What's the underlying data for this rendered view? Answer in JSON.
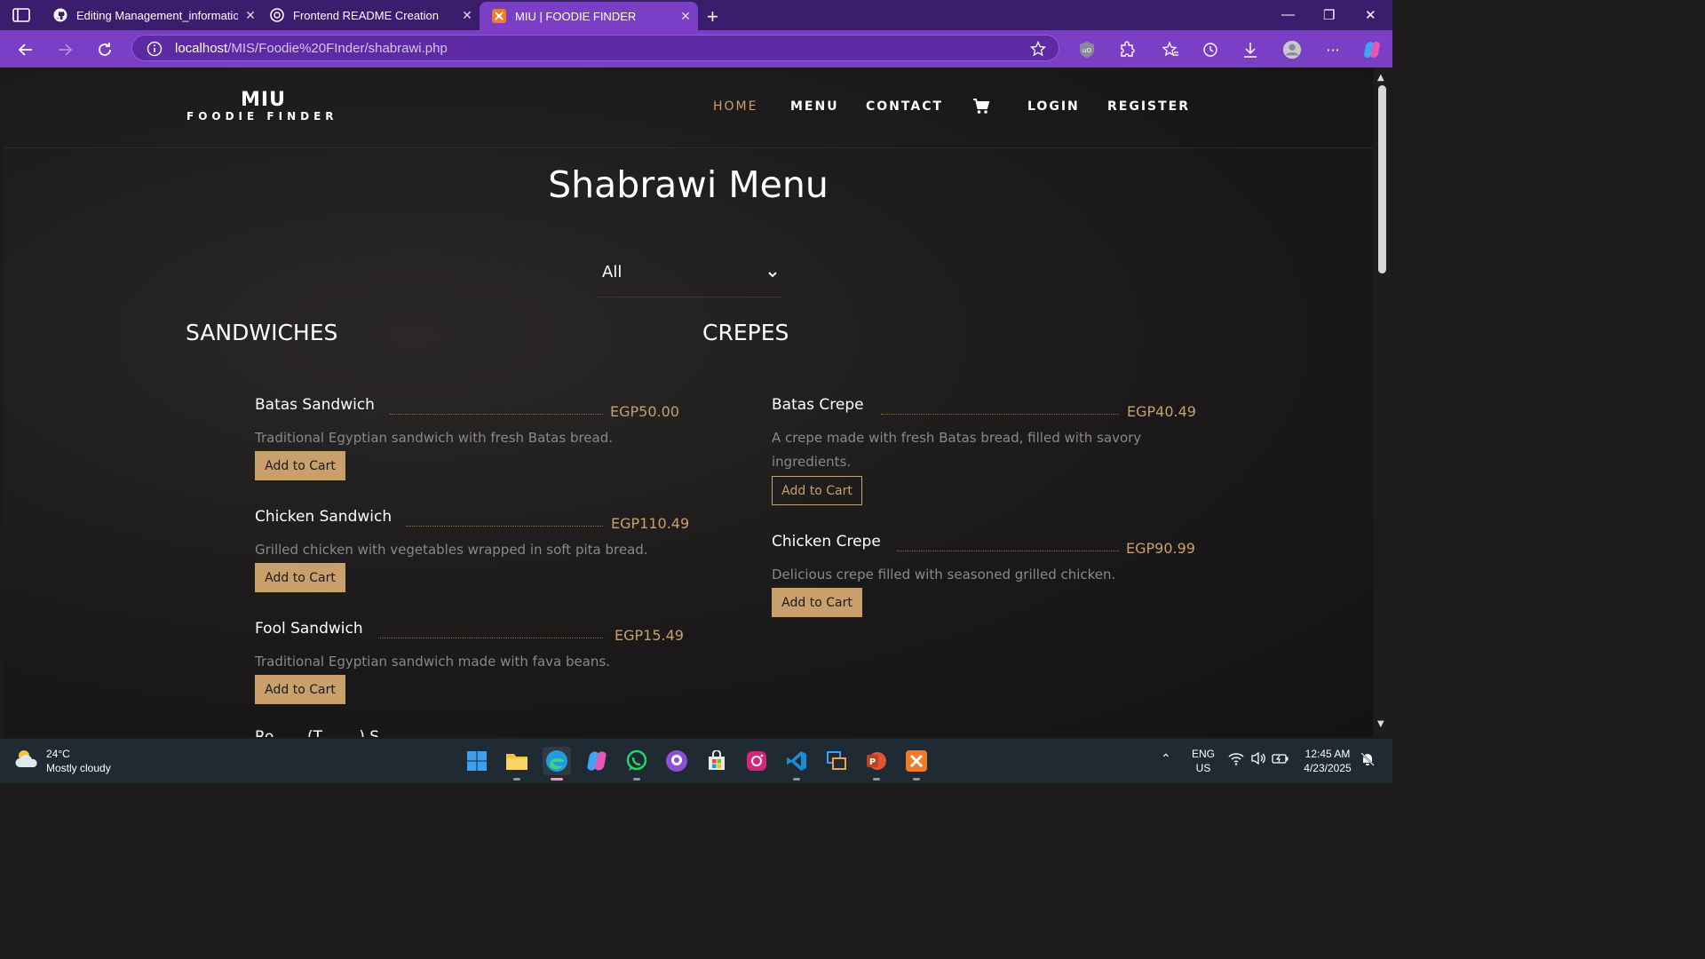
{
  "browser": {
    "tabs": [
      {
        "label": "Editing Management_information",
        "icon": "github-icon",
        "active": false
      },
      {
        "label": "Frontend README Creation",
        "icon": "chatgpt-icon",
        "active": false
      },
      {
        "label": "MIU | FOODIE FINDER",
        "icon": "xampp-icon",
        "active": true
      }
    ],
    "url_host": "localhost",
    "url_path": "/MIS/Foodie%20FInder/shabrawi.php"
  },
  "site": {
    "logo_top": "MIU",
    "logo_bottom": "FOODIE FINDER",
    "nav": [
      {
        "label": "HOME",
        "active": true
      },
      {
        "label": "MENU",
        "active": false
      },
      {
        "label": "CONTACT",
        "active": false
      },
      {
        "label": "LOGIN",
        "active": false
      },
      {
        "label": "REGISTER",
        "active": false
      }
    ],
    "accent": "#c9a06b"
  },
  "page": {
    "title": "Shabrawi Menu",
    "filter_value": "All"
  },
  "categories": [
    {
      "title": "SANDWICHES",
      "items": [
        {
          "name": "Batas Sandwich",
          "price": "EGP50.00",
          "desc": "Traditional Egyptian sandwich with fresh Batas bread.",
          "button": "Add to Cart"
        },
        {
          "name": "Chicken Sandwich",
          "price": "EGP110.49",
          "desc": "Grilled chicken with vegetables wrapped in soft pita bread.",
          "button": "Add to Cart"
        },
        {
          "name": "Fool Sandwich",
          "price": "EGP15.49",
          "desc": "Traditional Egyptian sandwich made with fava beans.",
          "button": "Add to Cart"
        },
        {
          "name": "Ro...... (T........) S.........",
          "price": "",
          "desc": "",
          "button": ""
        }
      ]
    },
    {
      "title": "CREPES",
      "items": [
        {
          "name": "Batas Crepe",
          "price": "EGP40.49",
          "desc": "A crepe made with fresh Batas bread, filled with savory",
          "desc2": "ingredients.",
          "button": "Add to Cart"
        },
        {
          "name": "Chicken Crepe",
          "price": "EGP90.99",
          "desc": "Delicious crepe filled with seasoned grilled chicken.",
          "button": "Add to Cart"
        }
      ]
    }
  ],
  "taskbar": {
    "weather_temp": "24°C",
    "weather_cond": "Mostly cloudy",
    "lang_top": "ENG",
    "lang_bottom": "US",
    "time": "12:45 AM",
    "date": "4/23/2025"
  }
}
